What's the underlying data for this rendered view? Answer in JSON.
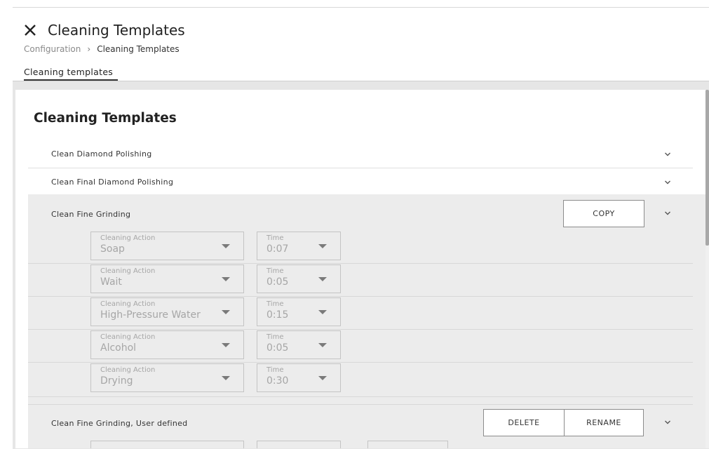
{
  "header": {
    "title": "Cleaning Templates",
    "breadcrumb": {
      "parent": "Configuration",
      "separator": "›",
      "current": "Cleaning Templates"
    },
    "tab": "Cleaning templates"
  },
  "panel": {
    "title": "Cleaning Templates",
    "templates": [
      {
        "name": "Clean Diamond Polishing"
      },
      {
        "name": "Clean Final Diamond Polishing"
      },
      {
        "name": "Clean Fine Grinding",
        "copy_label": "COPY",
        "steps": [
          {
            "action_label": "Cleaning Action",
            "action": "Soap",
            "time_label": "Time",
            "time": "0:07"
          },
          {
            "action_label": "Cleaning Action",
            "action": "Wait",
            "time_label": "Time",
            "time": "0:05"
          },
          {
            "action_label": "Cleaning Action",
            "action": "High-Pressure Water",
            "time_label": "Time",
            "time": "0:15"
          },
          {
            "action_label": "Cleaning Action",
            "action": "Alcohol",
            "time_label": "Time",
            "time": "0:05"
          },
          {
            "action_label": "Cleaning Action",
            "action": "Drying",
            "time_label": "Time",
            "time": "0:30"
          }
        ]
      },
      {
        "name": "Clean Fine Grinding, User defined",
        "delete_label": "DELETE",
        "rename_label": "RENAME"
      }
    ]
  },
  "icons": {
    "close": "close-icon",
    "chevron": "chevron-down-icon",
    "dropdown": "dropdown-arrow-icon"
  },
  "colors": {
    "panel_bg": "#ffffff",
    "expanded_bg": "#ececec",
    "outer_bg": "#e6e6e6",
    "text": "#333333",
    "muted": "#a6a6a6"
  }
}
